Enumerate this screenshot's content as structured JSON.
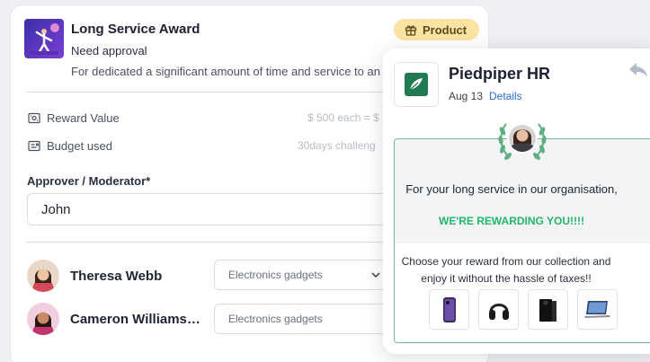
{
  "award": {
    "title": "Long Service Award",
    "status": "Need approval",
    "description": "For dedicated a significant amount of time and service to an",
    "badge": "Product",
    "reward_value_label": "Reward Value",
    "reward_value": "$ 500 each = $",
    "budget_label": "Budget used",
    "budget_value": "30days challeng",
    "approver_label": "Approver / Moderator*",
    "approver_value": "John",
    "people": [
      {
        "name": "Theresa Webb",
        "reward": "Electronics gadgets"
      },
      {
        "name": "Cameron Williamso...",
        "reward": "Electronics gadgets"
      }
    ]
  },
  "notification": {
    "brand": "Piedpiper HR",
    "date": "Aug 13",
    "details_link": "Details",
    "banner_line1": "For your long service in our organisation,",
    "banner_line2": "WE'RE REWARDING YOU!!!!",
    "choose_text": "Choose your reward from our collection and enjoy it without the hassle of taxes!!",
    "products": [
      "phone-icon",
      "headphones-icon",
      "game-console-icon",
      "laptop-icon"
    ]
  },
  "colors": {
    "accent_green": "#24b46a",
    "link_blue": "#2a6fd1",
    "badge_bg": "#fbe3a4",
    "brand_green": "#1f7a52"
  }
}
